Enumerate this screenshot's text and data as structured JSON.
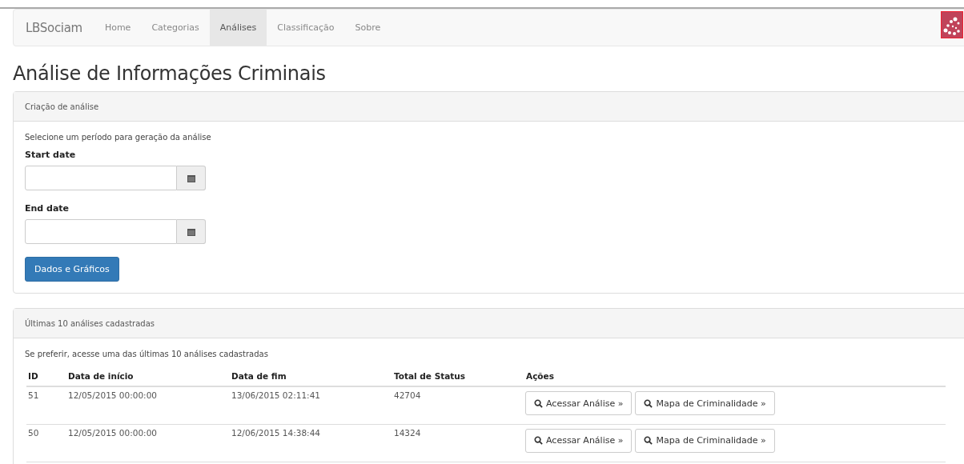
{
  "navbar": {
    "brand": "LBSociam",
    "items": [
      {
        "label": "Home",
        "selected": false
      },
      {
        "label": "Categorias",
        "selected": false
      },
      {
        "label": "Análises",
        "selected": true
      },
      {
        "label": "Classificação",
        "selected": false
      },
      {
        "label": "Sobre",
        "selected": false
      }
    ]
  },
  "title": "Análise de Informações Criminais",
  "creation_panel": {
    "heading": "Criação de análise",
    "intro": "Selecione um período para geração da análise",
    "fields": [
      {
        "label": "Start date"
      },
      {
        "label": "End date"
      }
    ],
    "submit": "Dados e Gráficos"
  },
  "recent_panel": {
    "heading": "Últimas 10 análises cadastradas",
    "intro": "Se preferir, acesse uma das últimas 10 análises cadastradas",
    "table": {
      "columns": [
        "ID",
        "Data de início",
        "Data de fim",
        "Total de Status",
        "Ações"
      ],
      "rows": [
        {
          "id": "51",
          "start": "12/05/2015 00:00:00",
          "end": "13/06/2015 02:11:41",
          "total": "42704",
          "actions": [
            "Acessar Análise »",
            "Mapa de Criminalidade »"
          ]
        },
        {
          "id": "50",
          "start": "12/05/2015 00:00:00",
          "end": "12/06/2015 14:38:44",
          "total": "14324",
          "actions": [
            "Acessar Análise »",
            "Mapa de Criminalidade »"
          ]
        }
      ]
    }
  }
}
